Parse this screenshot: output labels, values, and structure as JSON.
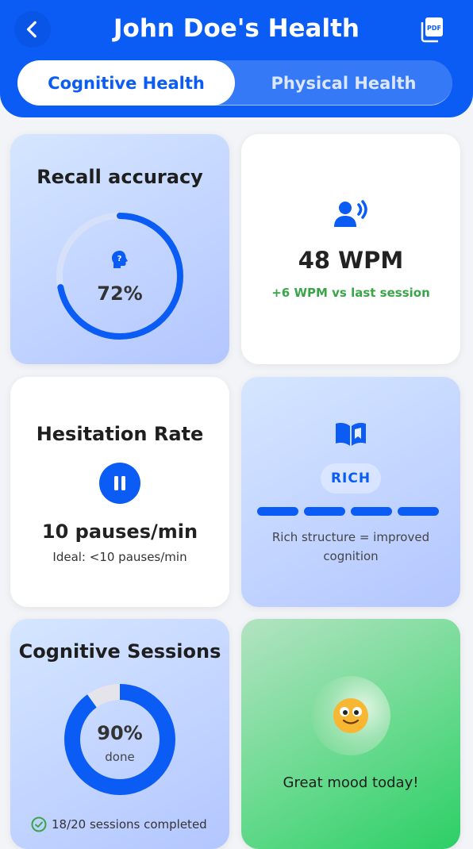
{
  "header": {
    "title": "John Doe's Health",
    "back_icon": "chevron-left-icon",
    "pdf_icon": "pdf-icon"
  },
  "tabs": [
    {
      "label": "Cognitive Health",
      "active": true
    },
    {
      "label": "Physical Health",
      "active": false
    }
  ],
  "cards": {
    "recall": {
      "title": "Recall accuracy",
      "icon": "brain-question-icon",
      "value_label": "72%",
      "progress": 0.72
    },
    "speech": {
      "icon": "speaking-person-icon",
      "value": "48 WPM",
      "delta": "+6 WPM vs last session"
    },
    "hesitation": {
      "title": "Hesitation Rate",
      "icon": "pause-icon",
      "value": "10 pauses/min",
      "ideal": "Ideal: <10 pauses/min"
    },
    "structure": {
      "icon": "open-book-icon",
      "badge": "RICH",
      "level_filled": 4,
      "level_total": 4,
      "caption": "Rich structure = improved cognition"
    },
    "sessions": {
      "title": "Cognitive Sessions",
      "value_label": "90%",
      "value_sub": "done",
      "progress": 0.9,
      "footer": "18/20 sessions completed",
      "footer_icon": "check-circle-icon"
    },
    "mood": {
      "icon": "smiling-face-icon",
      "text": "Great mood today!"
    }
  },
  "colors": {
    "primary": "#0a5cf5",
    "positive": "#3aa548",
    "ring_track": "#dbe3f7"
  }
}
